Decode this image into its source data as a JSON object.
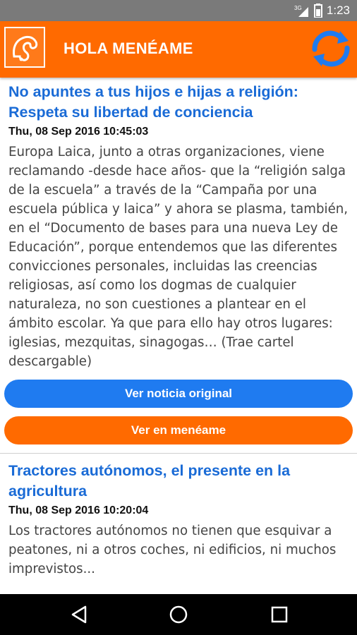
{
  "status_bar": {
    "time": "1:23",
    "network": "3G"
  },
  "app_bar": {
    "title": "HOLA MENÉAME"
  },
  "colors": {
    "accent": "#ff6a00",
    "link": "#1a6bd6",
    "button_blue": "#1f7bf0"
  },
  "items": [
    {
      "title": "No apuntes a tus hijos e hijas a religión: Respeta su libertad de conciencia",
      "date": "Thu, 08 Sep 2016 10:45:03",
      "body": "Europa Laica, junto a otras organizaciones, viene reclamando -desde hace años- que la “religión salga de la escuela” a través de la “Campaña por una escuela pública y laica” y ahora se plasma, también, en el “Documento de bases para una nueva Ley de Educación”, porque entendemos que las diferentes convicciones personales, incluidas las creencias religiosas, así como los dogmas de cualquier naturaleza, no son cuestiones a plantear en el ámbito escolar. Ya que para ello hay otros lugares: iglesias, mezquitas, sinagogas… (Trae cartel descargable)",
      "btn_original": "Ver noticia original",
      "btn_meneame": "Ver en menéame"
    },
    {
      "title": "Tractores autónomos, el presente en la agricultura",
      "date": "Thu, 08 Sep 2016 10:20:04",
      "body": "Los tractores autónomos no tienen que esquivar a peatones, ni a otros coches, ni edificios, ni muchos imprevistos..."
    }
  ]
}
